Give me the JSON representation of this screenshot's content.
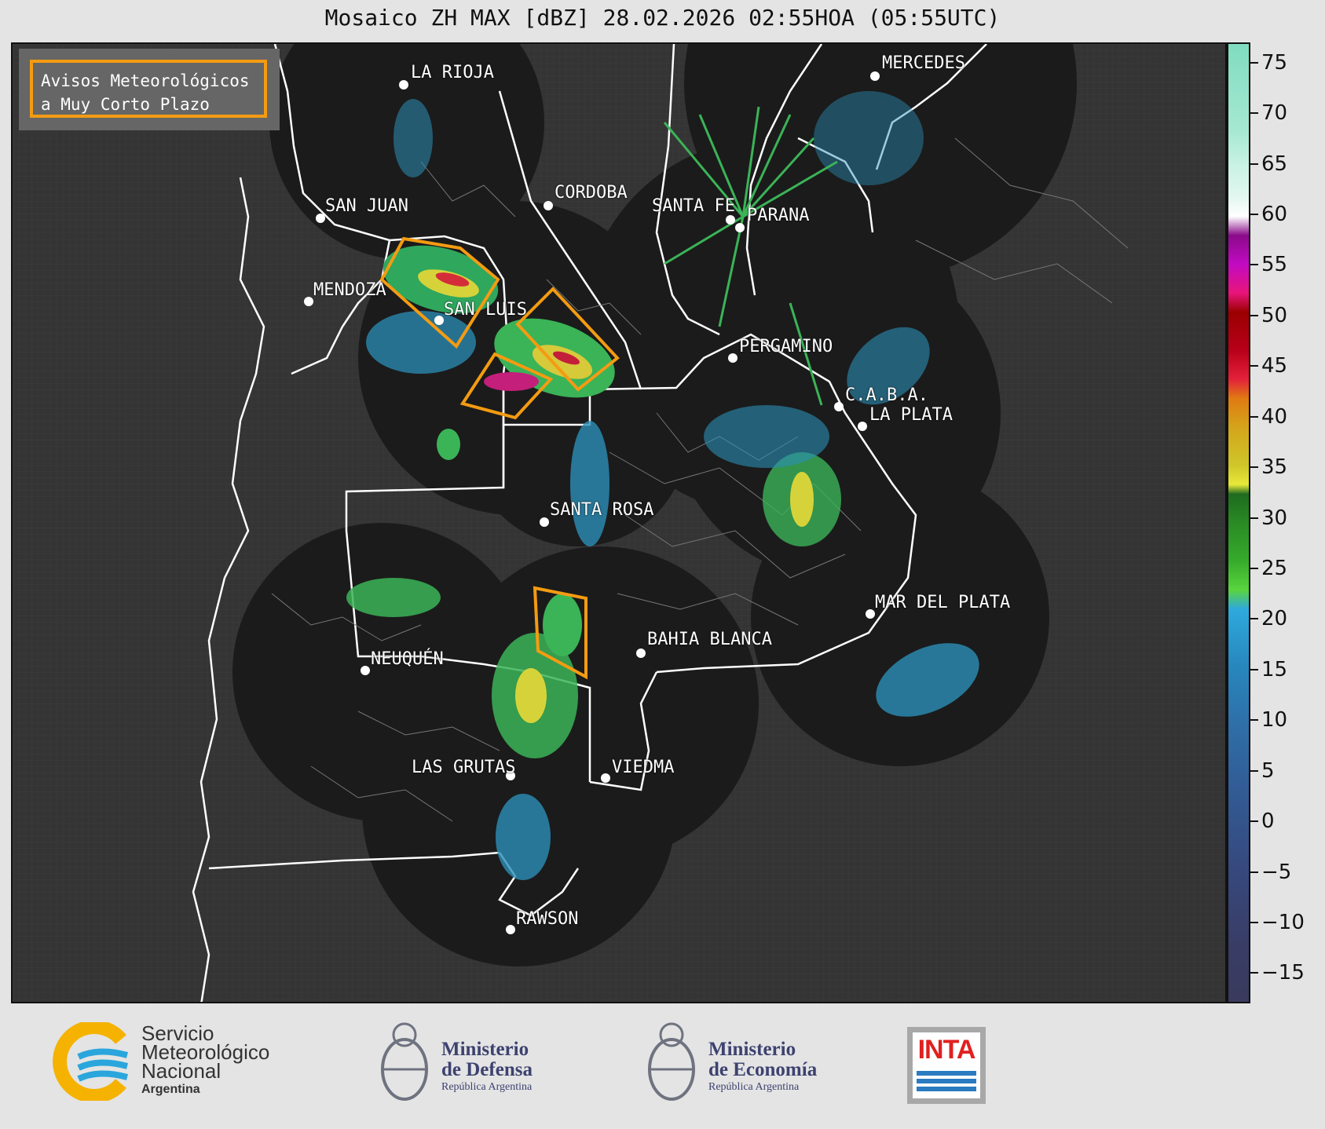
{
  "title": "Mosaico ZH MAX [dBZ] 28.02.2026 02:55HOA (05:55UTC)",
  "legend_box": {
    "line1": "Avisos Meteorológicos",
    "line2": "a Muy Corto Plazo"
  },
  "warning_color": "#f49b12",
  "cities": [
    {
      "name": "LA RIOJA",
      "id": "la-rioja"
    },
    {
      "name": "SAN JUAN",
      "id": "san-juan"
    },
    {
      "name": "CORDOBA",
      "id": "cordoba"
    },
    {
      "name": "SANTA FE",
      "id": "santa-fe"
    },
    {
      "name": "PARANA",
      "id": "parana"
    },
    {
      "name": "MERCEDES",
      "id": "mercedes"
    },
    {
      "name": "MENDOZA",
      "id": "mendoza"
    },
    {
      "name": "SAN LUIS",
      "id": "san-luis"
    },
    {
      "name": "PERGAMINO",
      "id": "pergamino"
    },
    {
      "name": "C.A.B.A.",
      "id": "caba"
    },
    {
      "name": "LA PLATA",
      "id": "la-plata"
    },
    {
      "name": "SANTA ROSA",
      "id": "santa-rosa"
    },
    {
      "name": "MAR DEL PLATA",
      "id": "mar-del-plata"
    },
    {
      "name": "BAHIA BLANCA",
      "id": "bahia-blanca"
    },
    {
      "name": "NEUQUÉN",
      "id": "neuquen"
    },
    {
      "name": "LAS GRUTAS",
      "id": "las-grutas"
    },
    {
      "name": "VIEDMA",
      "id": "viedma"
    },
    {
      "name": "RAWSON",
      "id": "rawson"
    }
  ],
  "colorbar": {
    "unit": "dBZ",
    "ticks": [
      "75",
      "70",
      "65",
      "60",
      "55",
      "50",
      "45",
      "40",
      "35",
      "30",
      "25",
      "20",
      "15",
      "10",
      "5",
      "0",
      "−5",
      "−10",
      "−15"
    ],
    "range": [
      -18,
      77
    ]
  },
  "footer": {
    "smn": {
      "line1": "Servicio",
      "line2": "Meteorológico",
      "line3": "Nacional",
      "line4": "Argentina"
    },
    "defensa": {
      "line1": "Ministerio",
      "line2": "de Defensa",
      "line3": "República Argentina"
    },
    "economia": {
      "line1": "Ministerio",
      "line2": "de Economía",
      "line3": "República Argentina"
    },
    "inta": "INTA"
  }
}
